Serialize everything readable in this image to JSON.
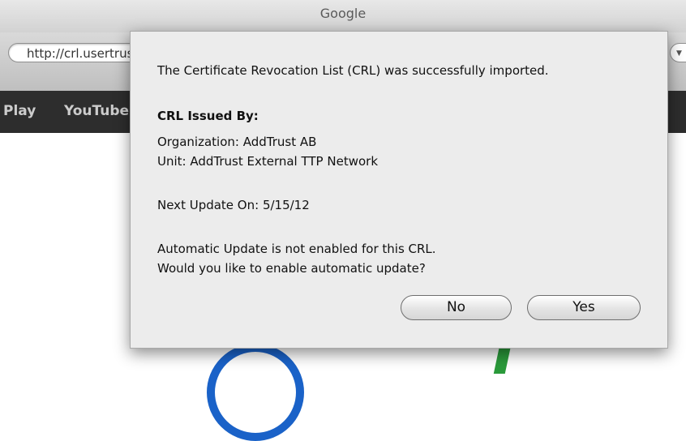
{
  "window": {
    "title": "Google"
  },
  "browser": {
    "url_value": "http://crl.usertrust.com/AddTrustExternalCARoot.crl",
    "google_bar": {
      "items": [
        "Play",
        "YouTube"
      ]
    }
  },
  "dialog": {
    "message": "The Certificate Revocation List (CRL) was successfully imported.",
    "issued_by_heading": "CRL Issued By:",
    "organization": "Organization: AddTrust AB",
    "unit": "Unit: AddTrust External TTP Network",
    "next_update": "Next Update On: 5/15/12",
    "auto_update_line1": "Automatic Update is not enabled for this CRL.",
    "auto_update_line2": "Would you like to enable automatic update?",
    "buttons": {
      "no": "No",
      "yes": "Yes"
    }
  }
}
